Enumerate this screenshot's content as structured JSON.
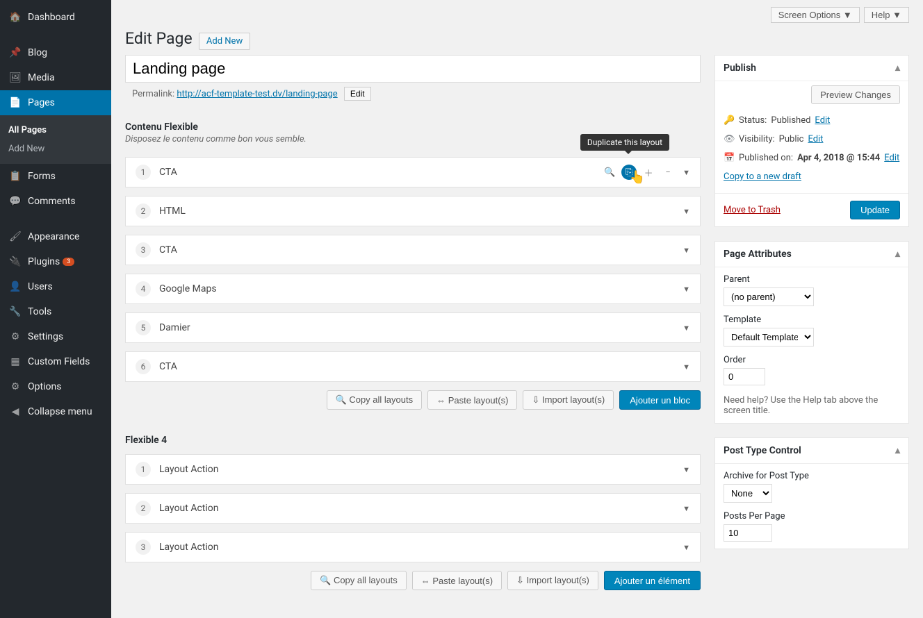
{
  "topright": {
    "screen_options": "Screen Options  ▼",
    "help": "Help  ▼"
  },
  "header": {
    "title": "Edit Page",
    "add_new": "Add New"
  },
  "title_input": "Landing page",
  "permalink": {
    "label": "Permalink:",
    "url_base": "http://acf-template-test.dv/",
    "slug": "landing-page",
    "edit": "Edit"
  },
  "sidebar": {
    "items": [
      {
        "label": "Dashboard",
        "icon": "🏠"
      },
      {
        "label": "Blog",
        "icon": "📌"
      },
      {
        "label": "Media",
        "icon": "🖼"
      },
      {
        "label": "Pages",
        "icon": "📄",
        "active": true
      },
      {
        "label": "Forms",
        "icon": "📋"
      },
      {
        "label": "Comments",
        "icon": "💬"
      },
      {
        "label": "Appearance",
        "icon": "🖌"
      },
      {
        "label": "Plugins",
        "icon": "🔌",
        "badge": "3"
      },
      {
        "label": "Users",
        "icon": "👤"
      },
      {
        "label": "Tools",
        "icon": "🔧"
      },
      {
        "label": "Settings",
        "icon": "⚙"
      },
      {
        "label": "Custom Fields",
        "icon": "▦"
      },
      {
        "label": "Options",
        "icon": "⚙"
      },
      {
        "label": "Collapse menu",
        "icon": "◀"
      }
    ],
    "sub": {
      "all_pages": "All Pages",
      "add_new": "Add New"
    }
  },
  "flexible1": {
    "title": "Contenu Flexible",
    "desc": "Disposez le contenu comme bon vous semble.",
    "tooltip": "Duplicate this layout",
    "rows": [
      {
        "num": "1",
        "label": "CTA"
      },
      {
        "num": "2",
        "label": "HTML"
      },
      {
        "num": "3",
        "label": "CTA"
      },
      {
        "num": "4",
        "label": "Google Maps"
      },
      {
        "num": "5",
        "label": "Damier"
      },
      {
        "num": "6",
        "label": "CTA"
      }
    ],
    "buttons": {
      "copy": "Copy all layouts",
      "paste": "Paste layout(s)",
      "import": "Import layout(s)",
      "add": "Ajouter un bloc"
    }
  },
  "flexible2": {
    "title": "Flexible 4",
    "rows": [
      {
        "num": "1",
        "label": "Layout Action"
      },
      {
        "num": "2",
        "label": "Layout Action"
      },
      {
        "num": "3",
        "label": "Layout Action"
      }
    ],
    "buttons": {
      "copy": "Copy all layouts",
      "paste": "Paste layout(s)",
      "import": "Import layout(s)",
      "add": "Ajouter un élément"
    }
  },
  "publish": {
    "title": "Publish",
    "preview": "Preview Changes",
    "status_label": "Status:",
    "status_value": "Published",
    "edit": "Edit",
    "visibility_label": "Visibility:",
    "visibility_value": "Public",
    "published_label": "Published on:",
    "published_value": "Apr 4, 2018 @ 15:44",
    "copy_draft": "Copy to a new draft",
    "trash": "Move to Trash",
    "update": "Update"
  },
  "page_attrs": {
    "title": "Page Attributes",
    "parent_label": "Parent",
    "parent_value": "(no parent)",
    "template_label": "Template",
    "template_value": "Default Template",
    "order_label": "Order",
    "order_value": "0",
    "help": "Need help? Use the Help tab above the screen title."
  },
  "post_type": {
    "title": "Post Type Control",
    "archive_label": "Archive for Post Type",
    "archive_value": "None",
    "ppp_label": "Posts Per Page",
    "ppp_value": "10"
  }
}
